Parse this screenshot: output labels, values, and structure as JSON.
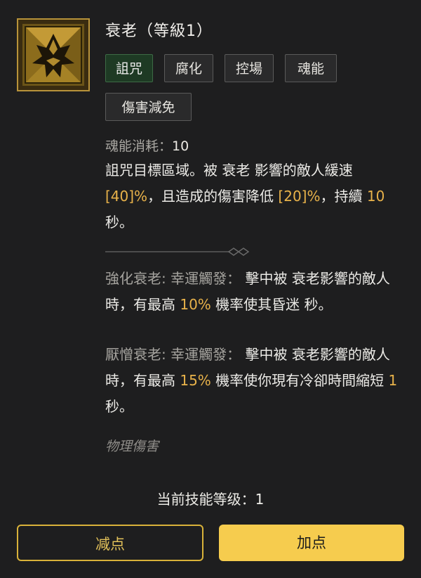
{
  "skill": {
    "title": "衰老（等級1）",
    "icon": "decrepify-skill-icon"
  },
  "tags": [
    "詛咒",
    "腐化",
    "控場",
    "魂能",
    "傷害減免"
  ],
  "cost": {
    "label": "魂能消耗：",
    "value": "10"
  },
  "description": {
    "p1": "詛咒目標區域。被",
    "keyword": "衰老",
    "p2": "影響的敵人緩速",
    "slow_value": "[40]%",
    "p3": "，且造成的傷害降低",
    "dmg_value": "[20]%",
    "p4": "，持續",
    "duration": "10",
    "p5": "秒。"
  },
  "upgrades": [
    {
      "name": "強化衰老: 幸運觸發：",
      "t1": "擊中被",
      "keyword": "衰老",
      "t2": "影響的敵人時，有最高",
      "chance": "10%",
      "t3": "機率使其昏迷",
      "t4": "秒。"
    },
    {
      "name": "厭憎衰老: 幸運觸發：",
      "t1": "擊中被",
      "keyword": "衰老",
      "t2": "影響的敵人時，有最高",
      "chance": "15%",
      "t3": "機率使你現有冷卻時間縮短",
      "value": "1",
      "t4": "秒。"
    }
  ],
  "damage_type": "物理傷害",
  "level": {
    "label": "当前技能等级：",
    "value": "1"
  },
  "buttons": {
    "minus": "减点",
    "plus": "加点"
  },
  "colors": {
    "highlight": "#e8b24a",
    "accent": "#f6cc4e",
    "active_tag": "#1e3a24"
  }
}
